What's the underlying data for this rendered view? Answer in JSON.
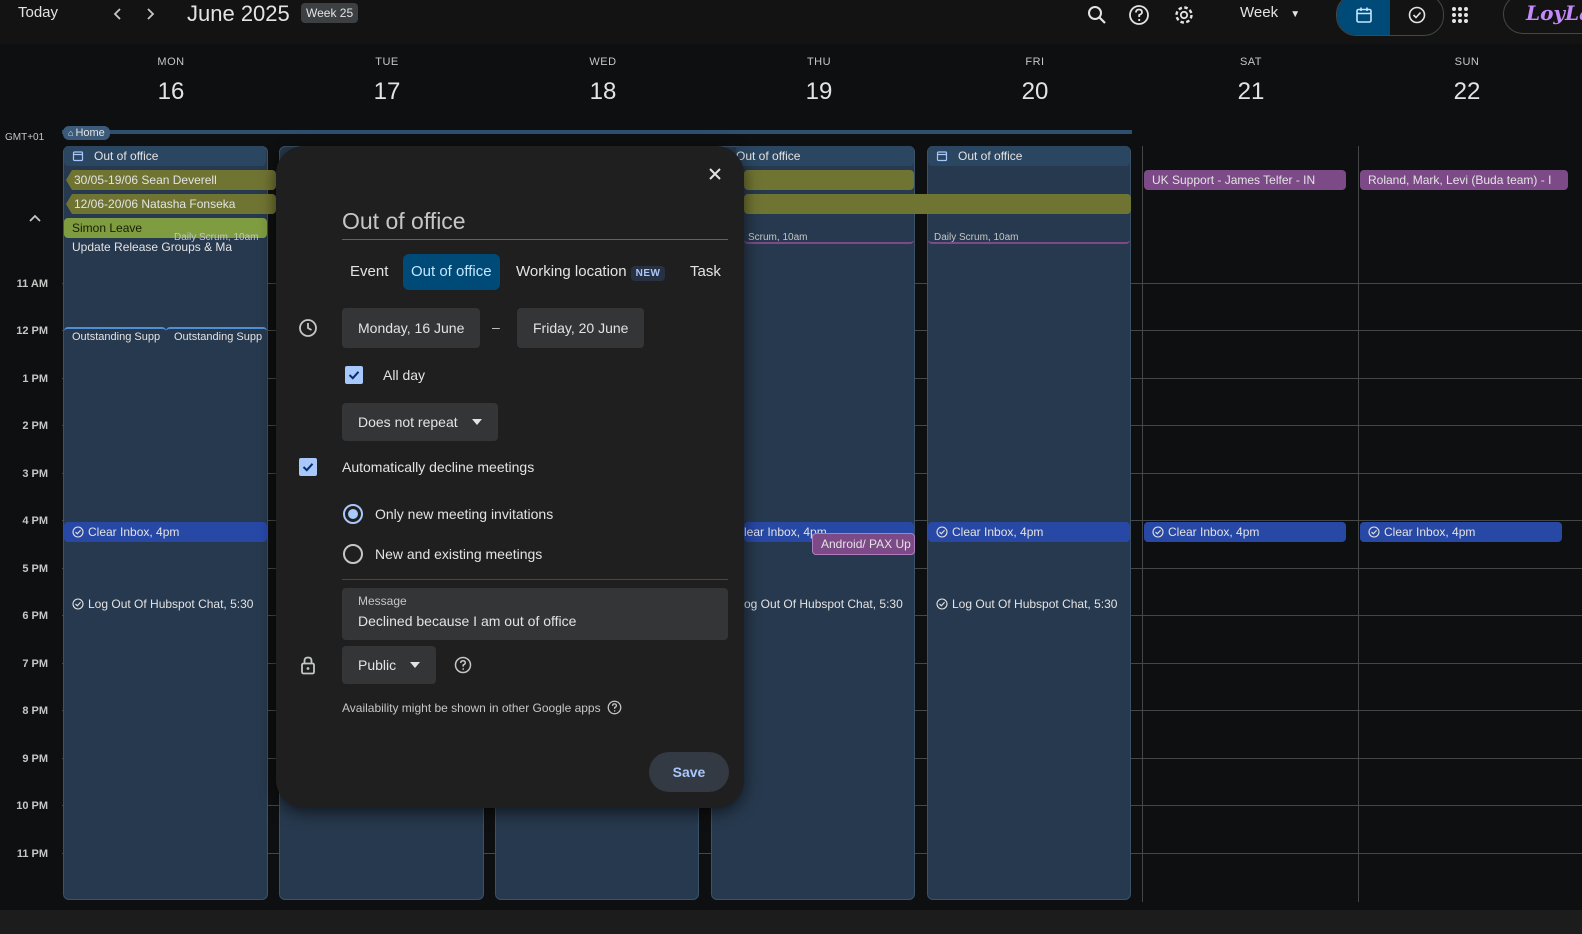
{
  "header": {
    "today_label": "Today",
    "prev_icon": "chevron-left-icon",
    "next_icon": "chevron-right-icon",
    "month_label": "June 2025",
    "week_badge": "Week 25",
    "view_label": "Week",
    "logo_text": "LoyLa"
  },
  "calendar": {
    "timezone": "GMT+01",
    "days": [
      {
        "name": "MON",
        "num": "16"
      },
      {
        "name": "TUE",
        "num": "17"
      },
      {
        "name": "WED",
        "num": "18"
      },
      {
        "name": "THU",
        "num": "19"
      },
      {
        "name": "FRI",
        "num": "20"
      },
      {
        "name": "SAT",
        "num": "21"
      },
      {
        "name": "SUN",
        "num": "22"
      }
    ],
    "hours": [
      "11 AM",
      "12 PM",
      "1 PM",
      "2 PM",
      "3 PM",
      "4 PM",
      "5 PM",
      "6 PM",
      "7 PM",
      "8 PM",
      "9 PM",
      "10 PM",
      "11 PM"
    ],
    "home_chip": "Home",
    "events": {
      "mon_ooo": "Out of office",
      "thu_ooo": "Out of office",
      "fri_ooo": "Out of office",
      "sean": "30/05-19/06 Sean Deverell",
      "natasha": "12/06-20/06 Natasha Fonseka",
      "simon": "Simon Leave",
      "update_release": "Update Release Groups & Ma",
      "daily_scrum_1": "Daily Scrum, 10am",
      "daily_scrum_thu": "Scrum, 10am",
      "daily_scrum_fri": "Daily Scrum, 10am",
      "outstanding_1": "Outstanding Supp",
      "outstanding_2": "Outstanding Supp",
      "uk_support": "UK Support - James Telfer - IN",
      "roland": "Roland, Mark, Levi (Buda team) - I",
      "clear_inbox_mon": "Clear Inbox, 4pm",
      "clear_inbox_thu": "lear Inbox, 4pm",
      "clear_inbox_fri": "Clear Inbox, 4pm",
      "clear_inbox_sat": "Clear Inbox, 4pm",
      "clear_inbox_sun": "Clear Inbox, 4pm",
      "android": "Android/ PAX Up",
      "logout_mon": "Log Out Of Hubspot Chat, 5:30",
      "logout_thu": "og Out Of Hubspot Chat, 5:30",
      "logout_fri": "Log Out Of Hubspot Chat, 5:30"
    }
  },
  "dialog": {
    "title": "Out of office",
    "tabs": [
      "Event",
      "Out of office",
      "Working location",
      "Task"
    ],
    "new_badge": "NEW",
    "start_date": "Monday, 16 June",
    "date_separator": "–",
    "end_date": "Friday, 20 June",
    "all_day_label": "All day",
    "all_day_checked": true,
    "repeat_value": "Does not repeat",
    "auto_decline_label": "Automatically decline meetings",
    "auto_decline_checked": true,
    "decline_options": [
      "Only new meeting invitations",
      "New and existing meetings"
    ],
    "decline_selected": "Only new meeting invitations",
    "message_label": "Message",
    "message_value": "Declined because I am out of office",
    "visibility_value": "Public",
    "availability_note": "Availability might be shown in other Google apps",
    "save_label": "Save"
  },
  "colors": {
    "background": "#131314",
    "accent": "#a8c7fa",
    "selected_tab": "#004a77",
    "ooo_block": "#27394e",
    "event_olive": "#707432",
    "event_purple": "#7c4a87",
    "task_blue": "#2748a5"
  }
}
